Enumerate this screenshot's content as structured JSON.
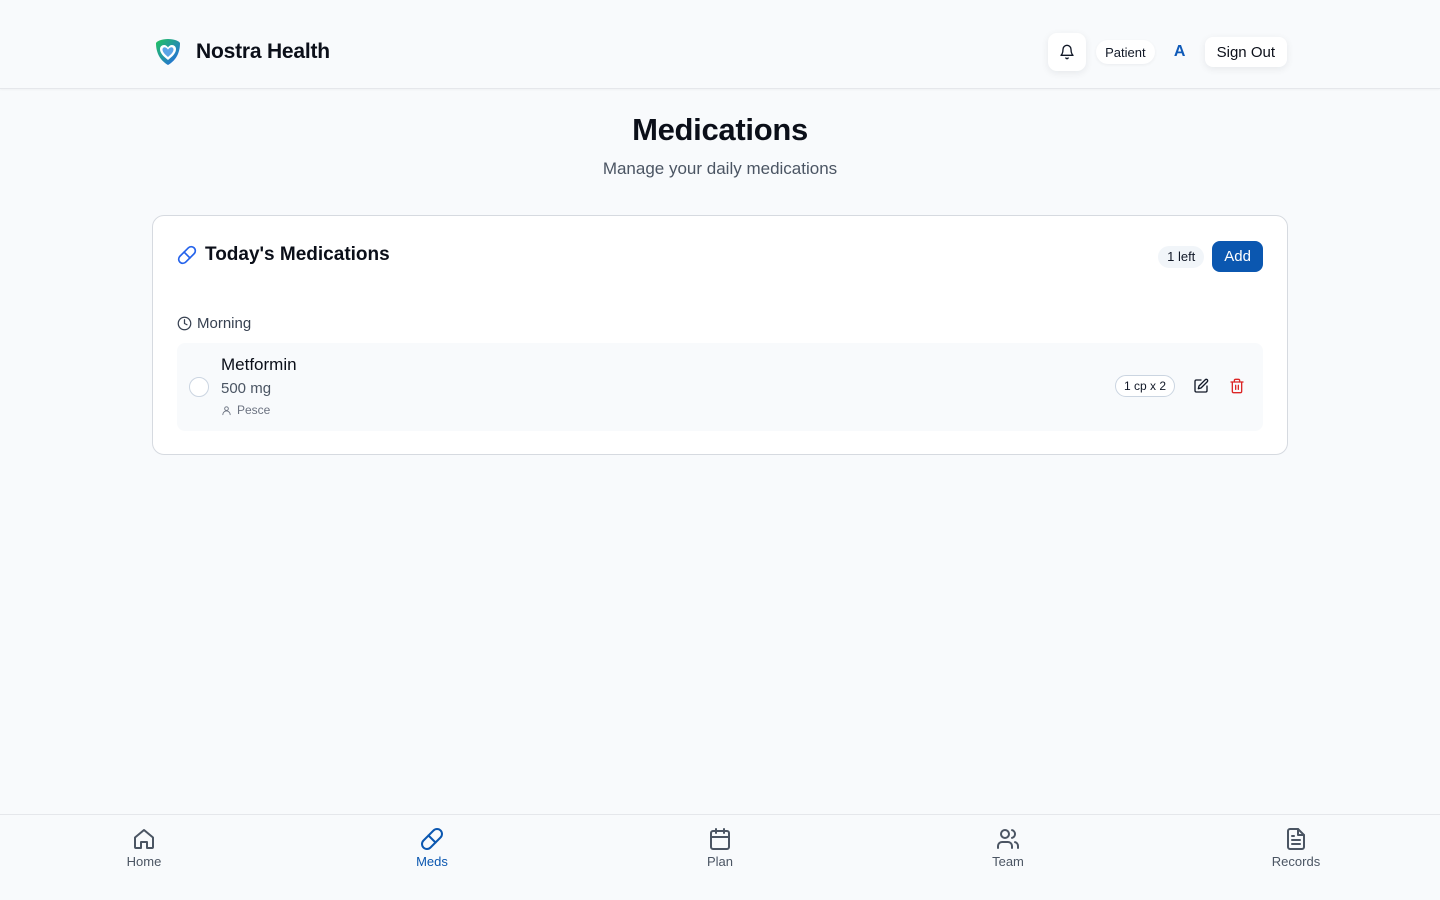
{
  "header": {
    "brand_name": "Nostra Health",
    "role": "Patient",
    "avatar_initial": "A",
    "sign_out_label": "Sign Out"
  },
  "page": {
    "title": "Medications",
    "subtitle": "Manage your daily medications"
  },
  "card": {
    "title": "Today's Medications",
    "remaining_badge": "1 left",
    "add_label": "Add",
    "sections": [
      {
        "label": "Morning",
        "items": [
          {
            "name": "Metformin",
            "dose": "500 mg",
            "patient": "Pesce",
            "frequency": "1 cp x 2",
            "taken": false
          }
        ]
      }
    ]
  },
  "nav": {
    "items": [
      {
        "label": "Home",
        "icon": "home-icon",
        "active": false
      },
      {
        "label": "Meds",
        "icon": "pill-icon",
        "active": true
      },
      {
        "label": "Plan",
        "icon": "calendar-icon",
        "active": false
      },
      {
        "label": "Team",
        "icon": "users-icon",
        "active": false
      },
      {
        "label": "Records",
        "icon": "file-text-icon",
        "active": false
      }
    ]
  },
  "colors": {
    "accent": "#0b57b0",
    "delete": "#dc2626",
    "background": "#f8fafc"
  }
}
